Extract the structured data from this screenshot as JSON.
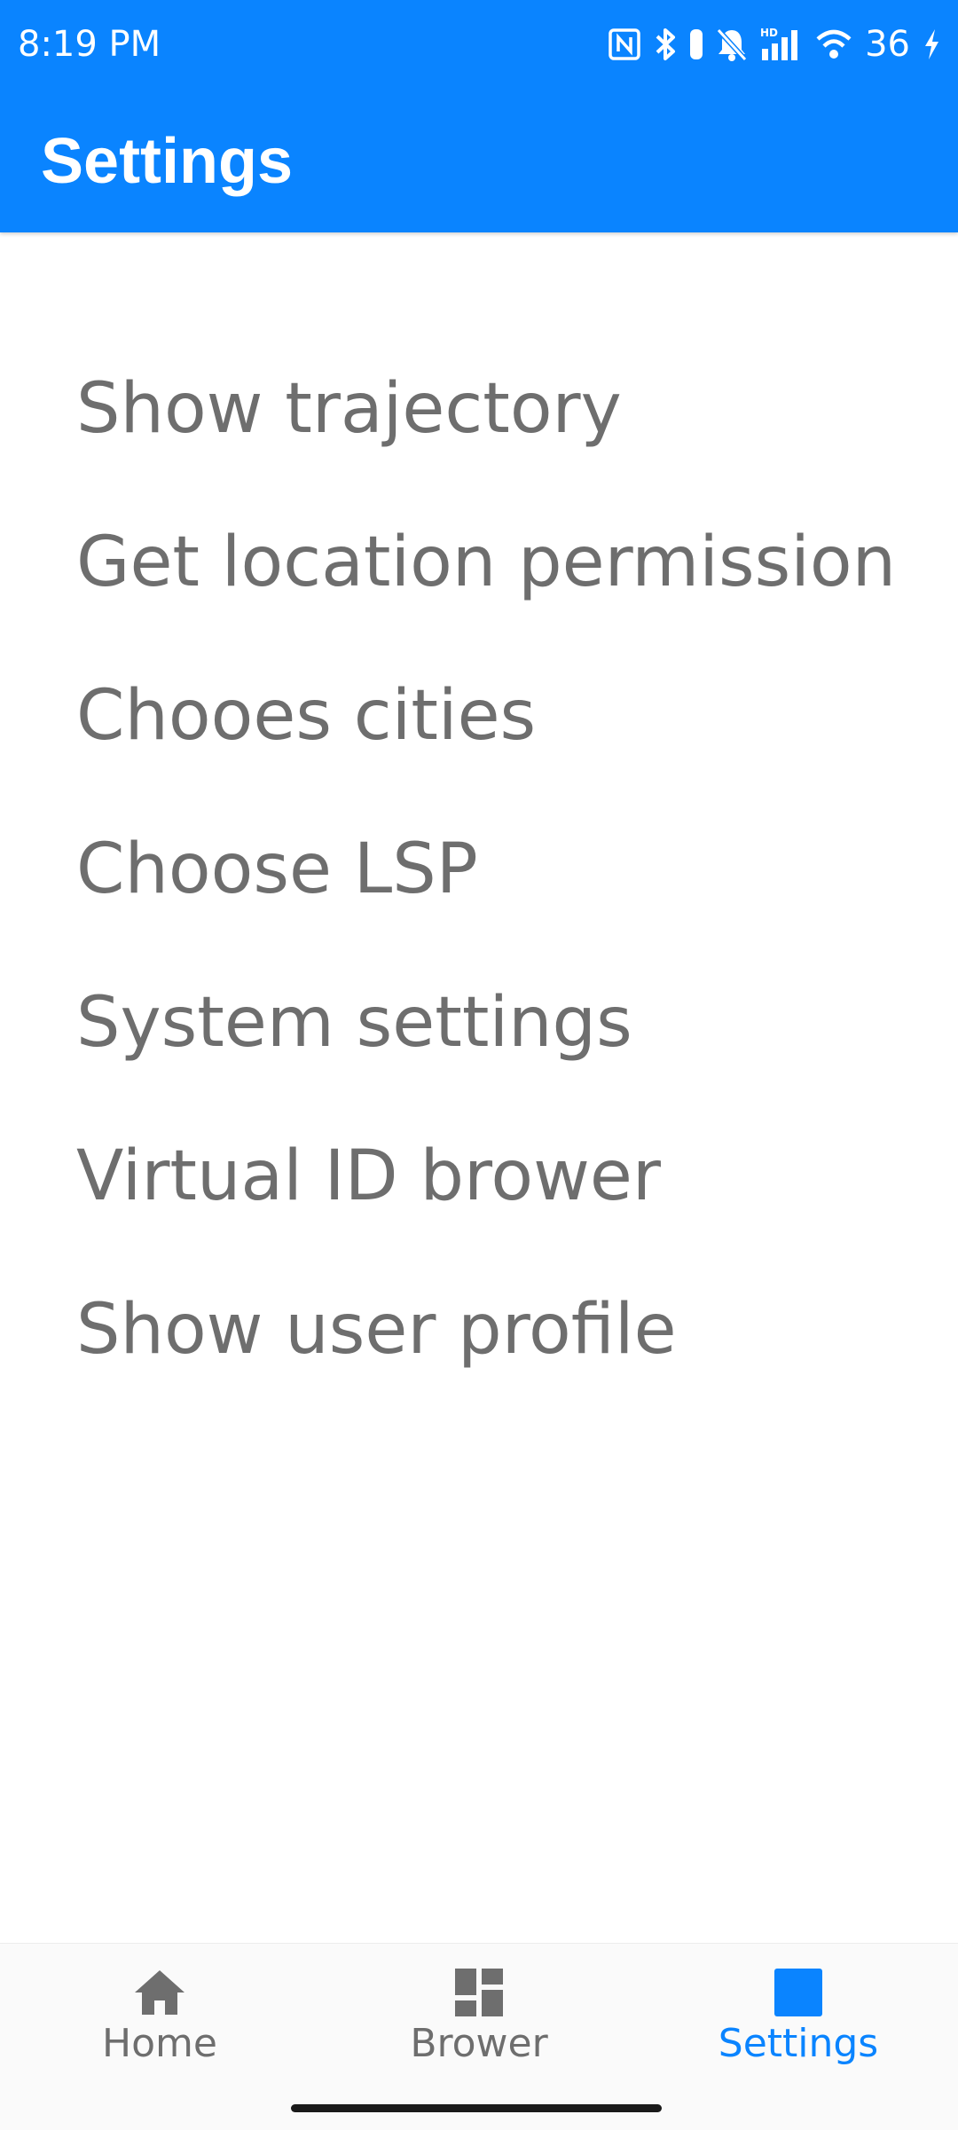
{
  "status_bar": {
    "time": "8:19 PM",
    "battery": "36",
    "icons": [
      "nfc-icon",
      "bluetooth-icon",
      "vibrate-icon",
      "mute-bell-icon",
      "hd-signal-icon",
      "wifi-icon",
      "charging-icon"
    ]
  },
  "header": {
    "title": "Settings",
    "background_color": "#0A84FF"
  },
  "settings": {
    "items": [
      {
        "label": "Show trajectory"
      },
      {
        "label": "Get location permission"
      },
      {
        "label": "Chooes cities"
      },
      {
        "label": "Choose LSP"
      },
      {
        "label": "System settings"
      },
      {
        "label": "Virtual ID brower"
      },
      {
        "label": "Show user profile"
      }
    ]
  },
  "bottom_nav": {
    "active_color": "#0A84FF",
    "inactive_color": "#6E6E6E",
    "items": [
      {
        "label": "Home",
        "icon": "home-icon",
        "active": false
      },
      {
        "label": "Brower",
        "icon": "dashboard-icon",
        "active": false
      },
      {
        "label": "Settings",
        "icon": "square-icon",
        "active": true
      }
    ]
  }
}
